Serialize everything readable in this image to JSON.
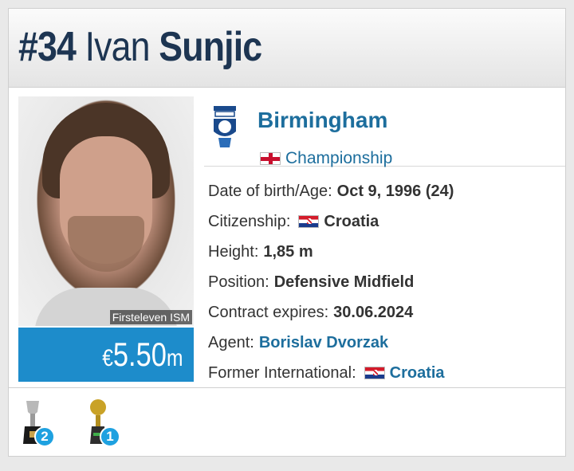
{
  "header": {
    "number": "#34",
    "first_name": "Ivan",
    "last_name": "Sunjic"
  },
  "photo": {
    "credit": "Firsteleven ISM"
  },
  "market_value": {
    "currency": "€",
    "amount": "5.50",
    "unit": "m"
  },
  "club": {
    "name": "Birmingham",
    "crest_icon": "birmingham-crest-icon",
    "league": "Championship",
    "league_flag": "england-flag-icon"
  },
  "details": {
    "dob_label": "Date of birth/Age:",
    "dob_value": "Oct 9, 1996 (24)",
    "citizenship_label": "Citizenship:",
    "citizenship_value": "Croatia",
    "height_label": "Height:",
    "height_value": "1,85 m",
    "position_label": "Position:",
    "position_value": "Defensive Midfield",
    "contract_label": "Contract expires:",
    "contract_value": "30.06.2024",
    "agent_label": "Agent:",
    "agent_value": "Borislav Dvorzak",
    "former_intl_label": "Former International:",
    "former_intl_value": "Croatia"
  },
  "trophies": [
    {
      "icon": "silver-cup-trophy-icon",
      "count": "2"
    },
    {
      "icon": "golden-ball-trophy-icon",
      "count": "1"
    }
  ],
  "colors": {
    "header_text": "#1d3552",
    "link": "#1d6e9d",
    "value_bg": "#1d8ccb",
    "badge": "#1ea1e0"
  }
}
